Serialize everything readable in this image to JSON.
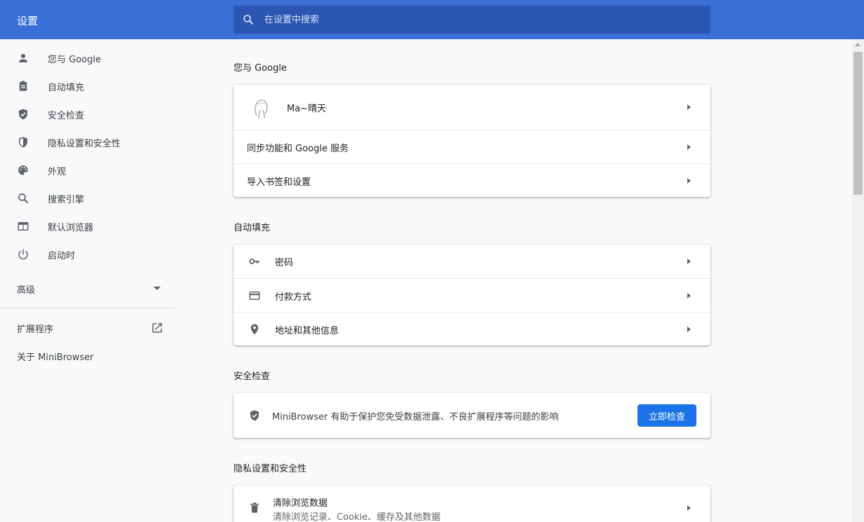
{
  "header": {
    "title": "设置",
    "search_placeholder": "在设置中搜索"
  },
  "sidebar": {
    "items": [
      {
        "label": "您与 Google",
        "icon": "person-icon"
      },
      {
        "label": "自动填充",
        "icon": "clipboard-icon"
      },
      {
        "label": "安全检查",
        "icon": "shield-check-icon"
      },
      {
        "label": "隐私设置和安全性",
        "icon": "privacy-shield-icon"
      },
      {
        "label": "外观",
        "icon": "palette-icon"
      },
      {
        "label": "搜索引擎",
        "icon": "search-icon"
      },
      {
        "label": "默认浏览器",
        "icon": "browser-window-icon"
      },
      {
        "label": "启动时",
        "icon": "power-icon"
      }
    ],
    "advanced_label": "高级",
    "extensions_label": "扩展程序",
    "about_label": "关于 MiniBrowser"
  },
  "sections": {
    "you_and_google": {
      "title": "您与 Google",
      "profile_name": "Ma~晴天",
      "sync_label": "同步功能和 Google 服务",
      "import_label": "导入书签和设置"
    },
    "autofill": {
      "title": "自动填充",
      "passwords_label": "密码",
      "payments_label": "付款方式",
      "addresses_label": "地址和其他信息"
    },
    "safety_check": {
      "title": "安全检查",
      "description": "MiniBrowser 有助于保护您免受数据泄露、不良扩展程序等问题的影响",
      "button_label": "立即检查"
    },
    "privacy": {
      "title": "隐私设置和安全性",
      "clear_data_label": "清除浏览数据",
      "clear_data_sub": "清除浏览记录、Cookie、缓存及其他数据"
    }
  },
  "colors": {
    "header_bg": "#3b6fd8",
    "search_bg": "#2b57b3",
    "accent": "#1a73e8",
    "page_bg": "#f8f9fa"
  }
}
